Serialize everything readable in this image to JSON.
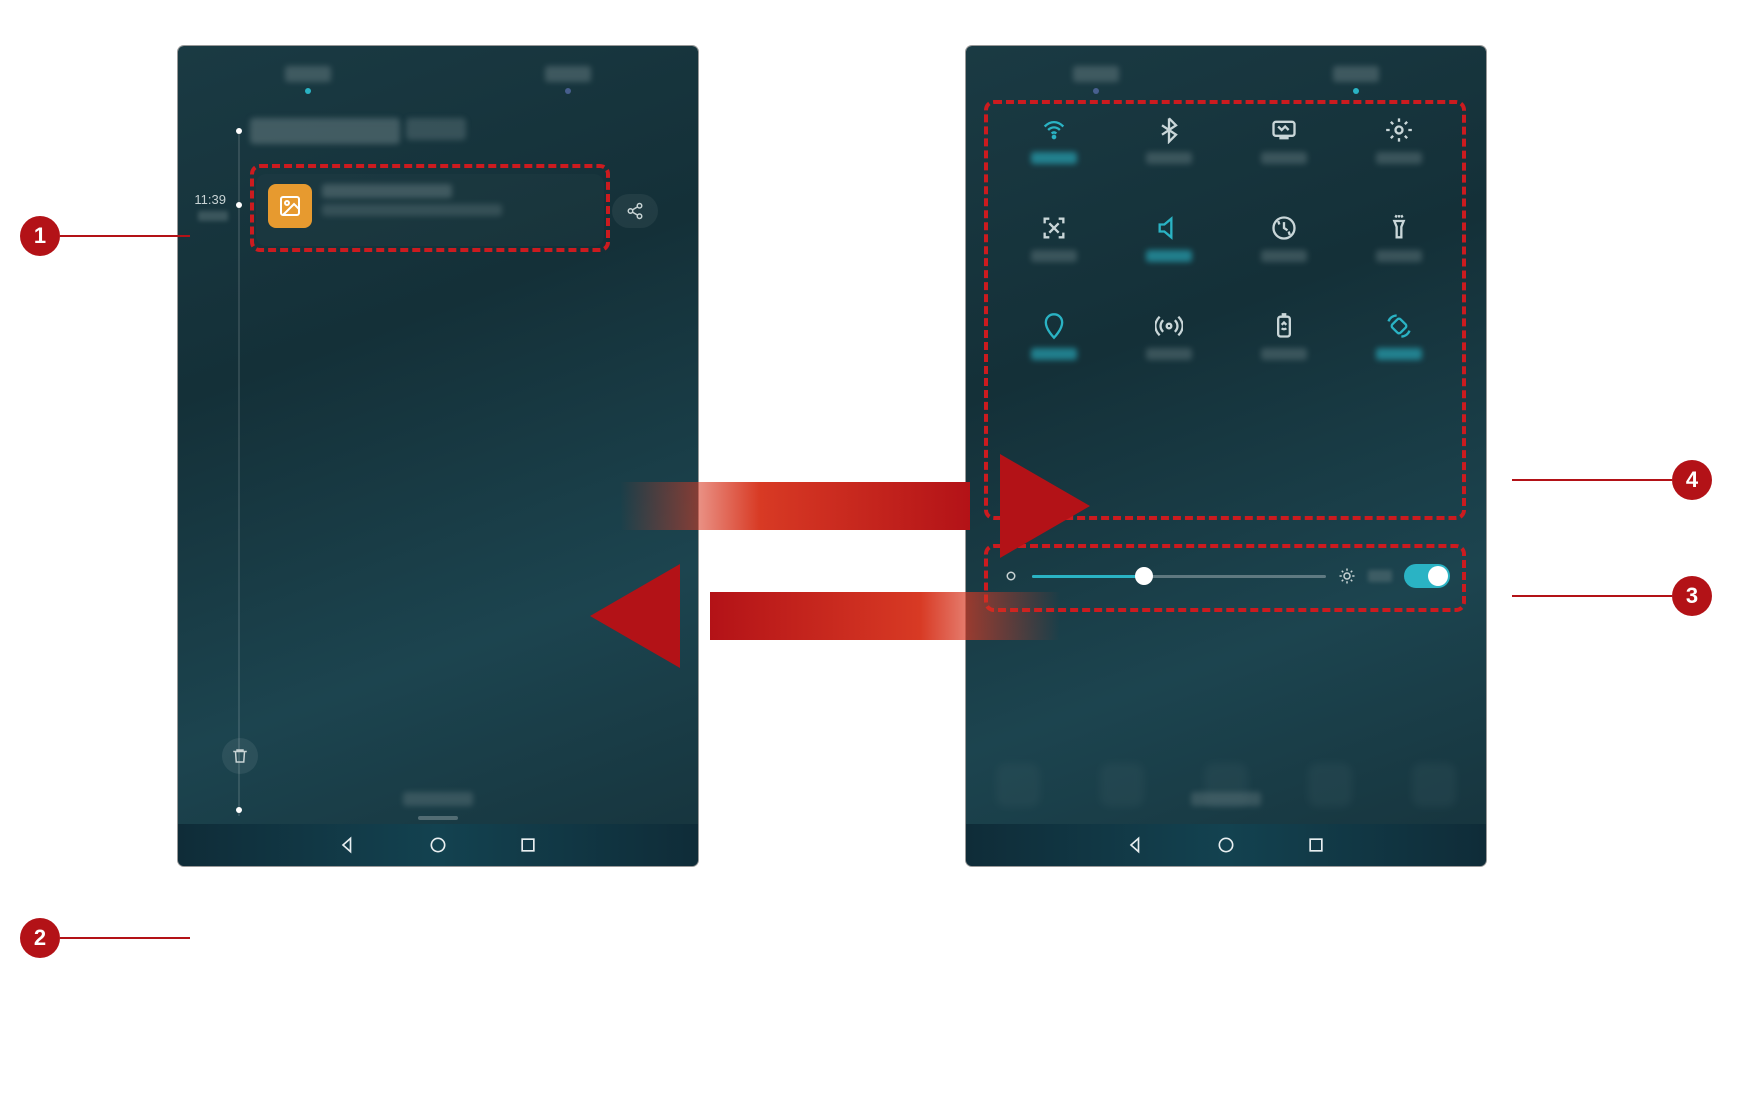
{
  "callouts": {
    "c1": "1",
    "c2": "2",
    "c3": "3",
    "c4": "4"
  },
  "left_panel": {
    "timestamp": "11:39",
    "notification_title": "",
    "notification_body": ""
  },
  "qs_toggles": [
    [
      {
        "k": "wifi",
        "on": true
      },
      {
        "k": "bluetooth",
        "on": false
      },
      {
        "k": "cast",
        "on": false
      },
      {
        "k": "settings",
        "on": false
      }
    ],
    [
      {
        "k": "screenshot",
        "on": false
      },
      {
        "k": "sound",
        "on": true
      },
      {
        "k": "sync",
        "on": false
      },
      {
        "k": "flashlight",
        "on": false
      }
    ],
    [
      {
        "k": "location",
        "on": true
      },
      {
        "k": "hotspot",
        "on": false
      },
      {
        "k": "battery",
        "on": false
      },
      {
        "k": "rotation",
        "on": true
      }
    ]
  ],
  "brightness": {
    "value_pct": 38,
    "auto_on": true
  }
}
